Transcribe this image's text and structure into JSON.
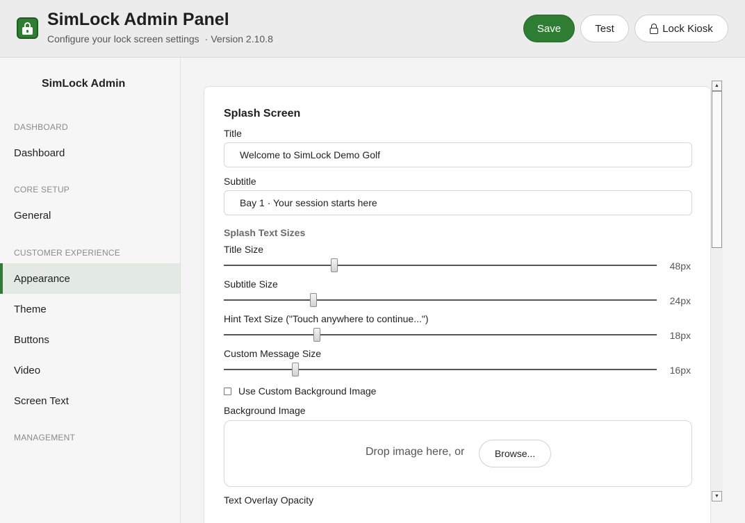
{
  "header": {
    "title": "SimLock Admin Panel",
    "subtitle": "Configure your lock screen settings",
    "separator": "·",
    "version": "Version 2.10.8",
    "buttons": {
      "save": "Save",
      "test": "Test",
      "lock_kiosk": "Lock Kiosk"
    },
    "logo_icon": "lock-screen-icon"
  },
  "colors": {
    "accent": "#2e7d32",
    "active_item_bg": "#e3e9e3"
  },
  "sidebar": {
    "brand": "SimLock Admin",
    "sections": {
      "dashboard": "DASHBOARD",
      "core_setup": "CORE SETUP",
      "customer_experience": "CUSTOMER EXPERIENCE",
      "management": "MANAGEMENT"
    },
    "items": {
      "dashboard": "Dashboard",
      "general": "General",
      "appearance": "Appearance",
      "theme": "Theme",
      "buttons": "Buttons",
      "video": "Video",
      "screen_text": "Screen Text"
    },
    "active_item": "Appearance"
  },
  "panel": {
    "title": "Splash Screen",
    "title_field": {
      "label": "Title",
      "value": "Welcome to SimLock Demo Golf"
    },
    "subtitle_field": {
      "label": "Subtitle",
      "value": "Bay 1 · Your session starts here"
    },
    "text_sizes_heading": "Splash Text Sizes",
    "sliders": {
      "title_size": {
        "label": "Title Size",
        "value_text": "48px",
        "fraction": 0.255
      },
      "subtitle_size": {
        "label": "Subtitle Size",
        "value_text": "24px",
        "fraction": 0.207
      },
      "hint_size": {
        "label": "Hint Text Size (\"Touch anywhere to continue...\")",
        "value_text": "18px",
        "fraction": 0.215
      },
      "message_size": {
        "label": "Custom Message Size",
        "value_text": "16px",
        "fraction": 0.165
      }
    },
    "custom_bg_checkbox": {
      "label": "Use Custom Background Image",
      "checked": false
    },
    "background_image": {
      "label": "Background Image",
      "drop_text": "Drop image here, or",
      "browse_label": "Browse..."
    },
    "text_overlay_label": "Text Overlay Opacity"
  }
}
